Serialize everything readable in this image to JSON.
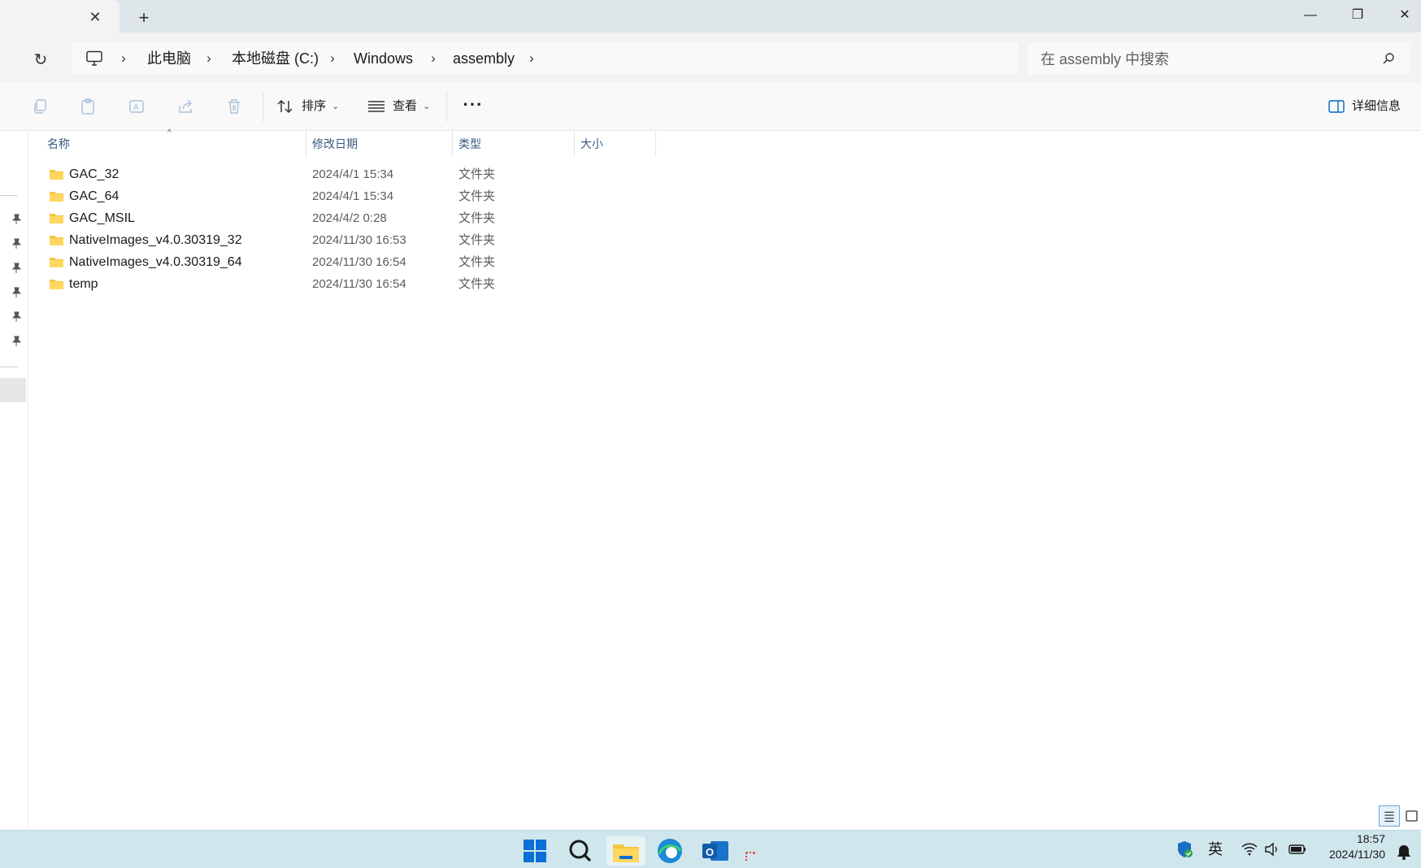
{
  "tab": {
    "close_glyph": "✕",
    "new_glyph": "+"
  },
  "window_controls": {
    "minimize": "—",
    "maximize": "❐",
    "close": "✕"
  },
  "address": {
    "crumbs": [
      "此电脑",
      "本地磁盘 (C:)",
      "Windows",
      "assembly"
    ],
    "chevron": "›"
  },
  "search": {
    "placeholder": "在 assembly 中搜索"
  },
  "toolbar": {
    "sort_label": "排序",
    "view_label": "查看",
    "more_label": "···",
    "details_label": "详细信息",
    "dropdown_glyph": "⌄"
  },
  "columns": {
    "name": "名称",
    "date": "修改日期",
    "type": "类型",
    "size": "大小"
  },
  "files": [
    {
      "name": "GAC_32",
      "date": "2024/4/1 15:34",
      "type": "文件夹"
    },
    {
      "name": "GAC_64",
      "date": "2024/4/1 15:34",
      "type": "文件夹"
    },
    {
      "name": "GAC_MSIL",
      "date": "2024/4/2 0:28",
      "type": "文件夹"
    },
    {
      "name": "NativeImages_v4.0.30319_32",
      "date": "2024/11/30 16:53",
      "type": "文件夹"
    },
    {
      "name": "NativeImages_v4.0.30319_64",
      "date": "2024/11/30 16:54",
      "type": "文件夹"
    },
    {
      "name": "temp",
      "date": "2024/11/30 16:54",
      "type": "文件夹"
    }
  ],
  "taskbar": {
    "ime": "英",
    "time": "18:57",
    "date": "2024/11/30"
  },
  "colors": {
    "folder": "#f4c542",
    "header_text": "#3a5a80",
    "taskbar_bg": "#cfe6ec",
    "accent": "#0067c0"
  }
}
